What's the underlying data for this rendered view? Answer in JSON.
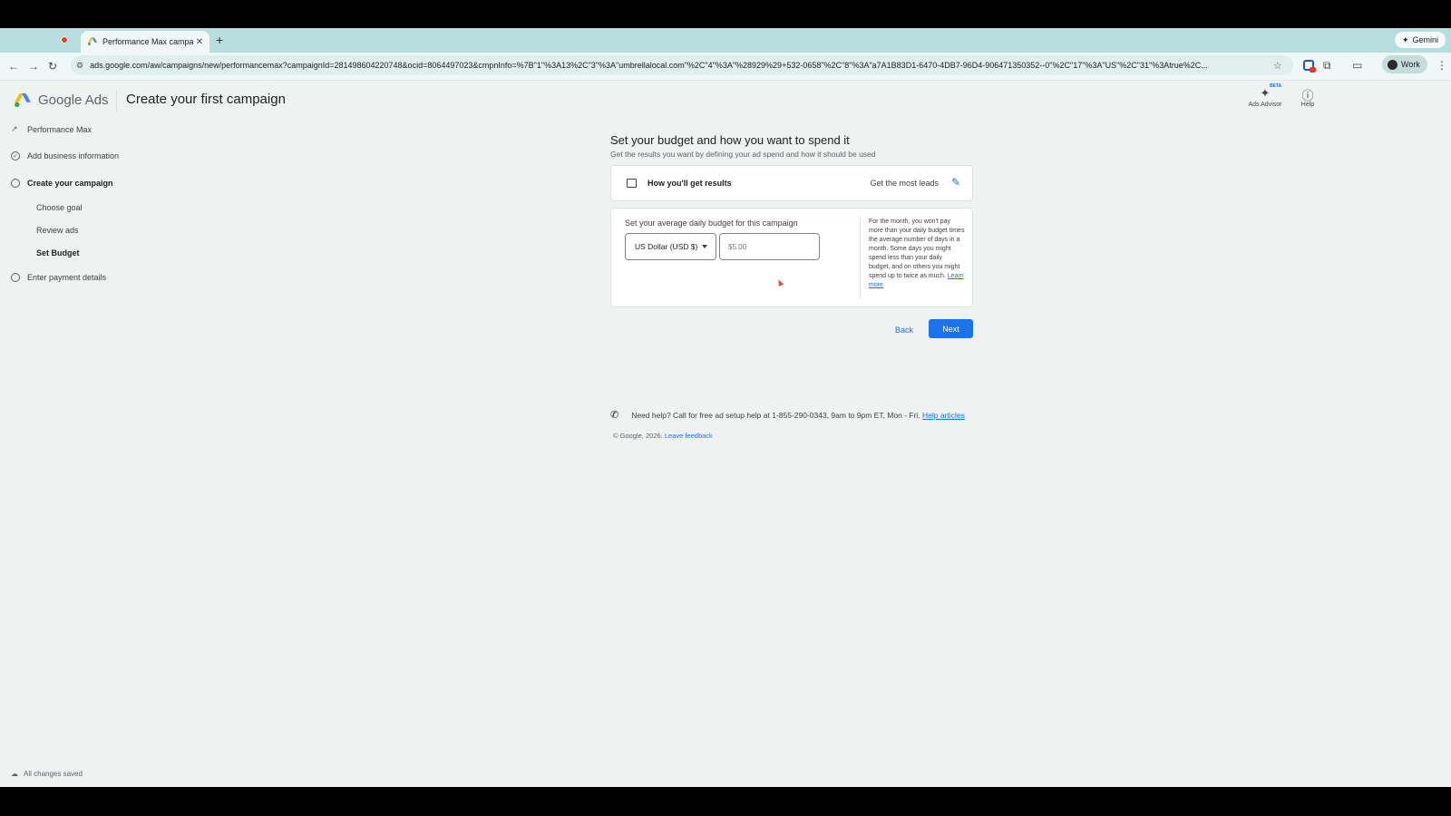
{
  "browser": {
    "tab_title": "Performance Max campaign -",
    "new_tab": "+",
    "gemini_label": "Gemini",
    "url": "ads.google.com/aw/campaigns/new/performancemax?campaignId=281498604220748&ocid=8064497023&cmpnInfo=%7B\"1\"%3A13%2C\"3\"%3A\"umbrellalocal.com\"%2C\"4\"%3A\"%28929%29+532-0658\"%2C\"8\"%3A\"a7A1B83D1-6470-4DB7-96D4-906471350352--0\"%2C\"17\"%3A\"US\"%2C\"31\"%3Atrue%2C...",
    "profile_label": "Work"
  },
  "header": {
    "brand": "Google Ads",
    "page_title": "Create your first campaign",
    "ads_advisor_label": "Ads Advisor",
    "beta_badge": "BETA",
    "help_label": "Help"
  },
  "stepper": {
    "steps": [
      {
        "label": "Performance Max"
      },
      {
        "label": "Add business information"
      },
      {
        "label": "Create your campaign"
      },
      {
        "label": "Enter payment details"
      }
    ],
    "substeps": [
      {
        "label": "Choose goal"
      },
      {
        "label": "Review ads"
      },
      {
        "label": "Set Budget"
      }
    ]
  },
  "main": {
    "heading": "Set your budget and how you want to spend it",
    "subheading": "Get the results you want by defining your ad spend and how it should be used",
    "results_card": {
      "label": "How you'll get results",
      "value": "Get the most leads"
    },
    "budget_card": {
      "label": "Set your average daily budget for this campaign",
      "currency": "US Dollar (USD $)",
      "amount_placeholder": "$5.00",
      "note": "For the month, you won't pay more than your daily budget times the average number of days in a month. Some days you might spend less than your daily budget, and on others you might spend up to twice as much.",
      "learn_more": "Learn more"
    },
    "back_label": "Back",
    "next_label": "Next",
    "help_text": "Need help? Call for free ad setup help at 1-855-290-0343, 9am to 9pm ET, Mon - Fri.",
    "help_link": "Help articles",
    "copyright": "© Google, 2026.",
    "feedback_link": "Leave feedback"
  },
  "status": {
    "saved_text": "All changes saved"
  },
  "colors": {
    "accent": "#1a73e8",
    "tab_strip": "#b6dede",
    "page_bg": "#f0f2f2"
  },
  "icons": [
    "record-dot-icon",
    "google-ads-favicon",
    "close-icon",
    "back-arrow-icon",
    "forward-arrow-icon",
    "reload-icon",
    "site-info-icon",
    "star-icon",
    "extensions-icon",
    "sidepanel-icon",
    "sparkle-icon",
    "help-circle-icon",
    "trend-icon",
    "check-circle-icon",
    "circle-icon",
    "chart-icon",
    "pencil-icon",
    "caret-down-icon",
    "phone-icon",
    "cloud-icon"
  ]
}
